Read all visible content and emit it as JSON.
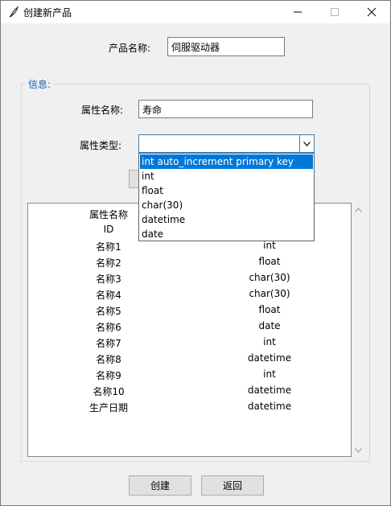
{
  "window": {
    "title": "创建新产品",
    "minimize_glyph": "—",
    "maximize_glyph": "□",
    "close_glyph": "✕",
    "icon": "feather-icon"
  },
  "form": {
    "product_name_label": "产品名称:",
    "product_name_value": "伺服驱动器"
  },
  "info": {
    "group_title": "信息:",
    "attr_name_label": "属性名称:",
    "attr_name_value": "寿命",
    "attr_type_label": "属性类型:",
    "attr_type_value": ""
  },
  "dropdown": {
    "options": [
      "int auto_increment primary key",
      "int",
      "float",
      "char(30)",
      "datetime",
      "date"
    ],
    "selected_index": 0
  },
  "table": {
    "rows": [
      {
        "name": "属性名称",
        "type": ""
      },
      {
        "name": "ID",
        "type": "ry key"
      },
      {
        "name": "名称1",
        "type": "int"
      },
      {
        "name": "名称2",
        "type": "float"
      },
      {
        "name": "名称3",
        "type": "char(30)"
      },
      {
        "name": "名称4",
        "type": "char(30)"
      },
      {
        "name": "名称5",
        "type": "float"
      },
      {
        "name": "名称6",
        "type": "date"
      },
      {
        "name": "名称7",
        "type": "int"
      },
      {
        "name": "名称8",
        "type": "datetime"
      },
      {
        "name": "名称9",
        "type": "int"
      },
      {
        "name": "名称10",
        "type": "datetime"
      },
      {
        "name": "生产日期",
        "type": "datetime"
      }
    ]
  },
  "buttons": {
    "create": "创建",
    "back": "返回"
  },
  "colors": {
    "accent": "#0078d7",
    "group_title": "#1c5ea8"
  }
}
